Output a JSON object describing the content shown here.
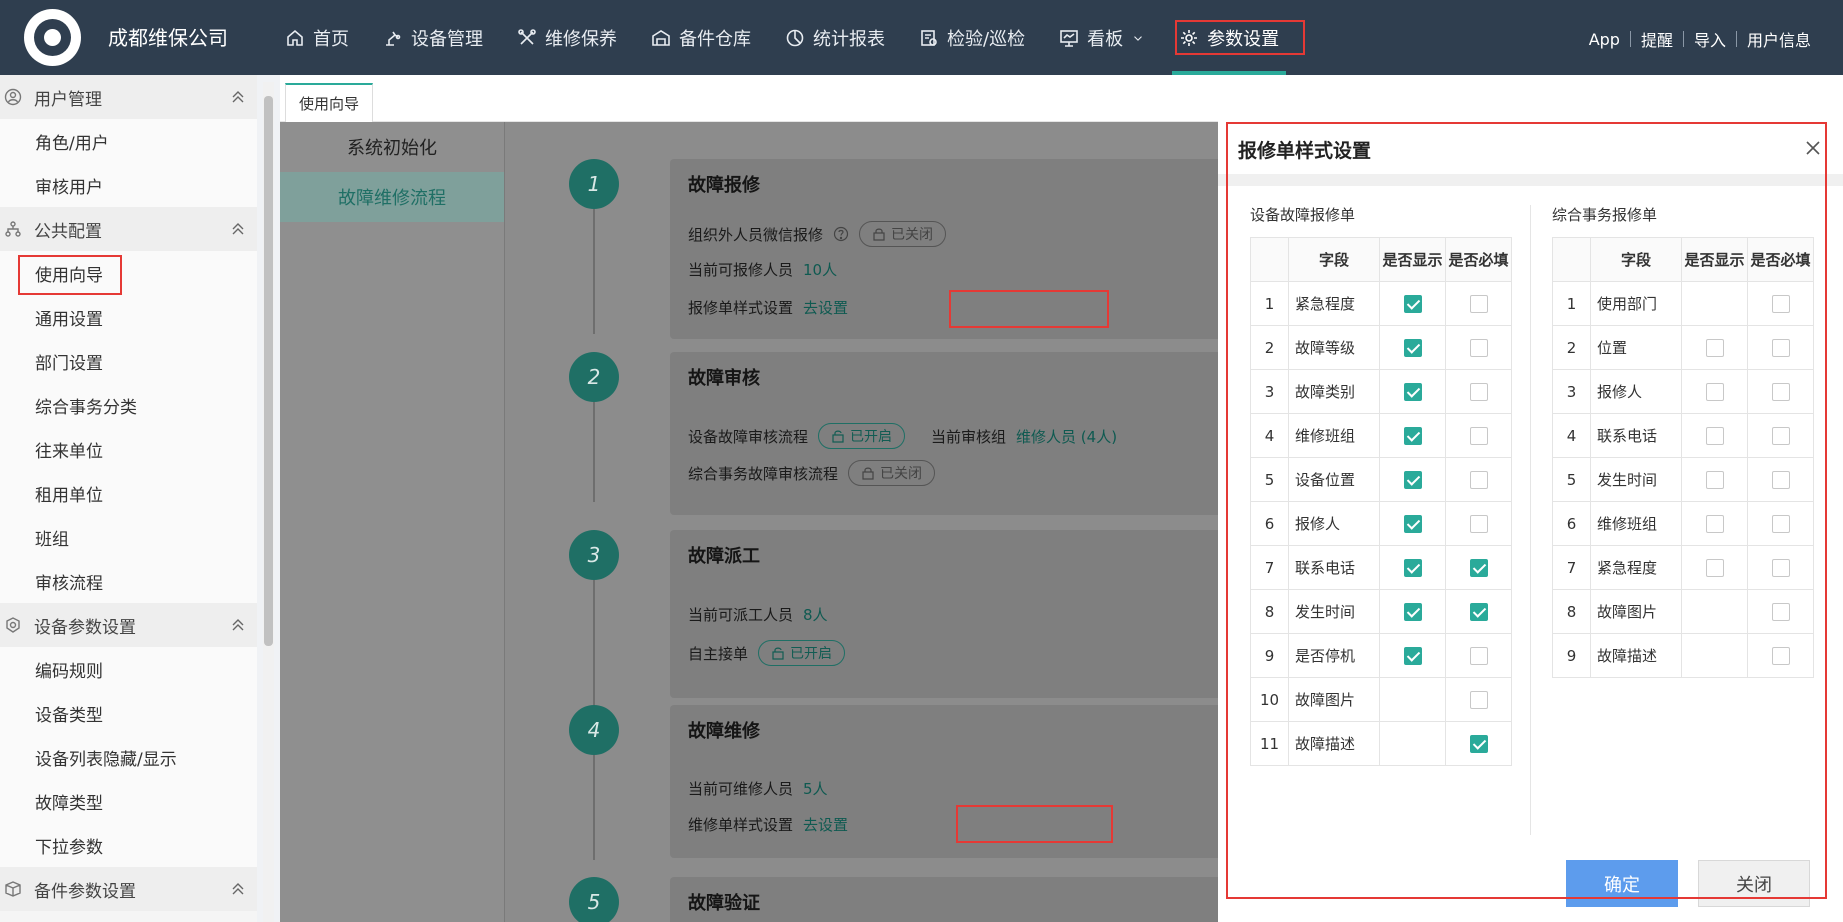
{
  "header": {
    "company": "成都维保公司",
    "nav": [
      {
        "label": "首页",
        "icon": "home-icon"
      },
      {
        "label": "设备管理",
        "icon": "robot-arm-icon"
      },
      {
        "label": "维修保养",
        "icon": "tools-icon"
      },
      {
        "label": "备件仓库",
        "icon": "warehouse-icon"
      },
      {
        "label": "统计报表",
        "icon": "pie-chart-icon"
      },
      {
        "label": "检验/巡检",
        "icon": "inspection-icon"
      },
      {
        "label": "看板",
        "icon": "board-icon"
      },
      {
        "label": "参数设置",
        "icon": "gear-icon"
      }
    ],
    "right": [
      "App",
      "提醒",
      "导入",
      "用户信息"
    ]
  },
  "sidebar": {
    "groups": [
      {
        "label": "用户管理",
        "icon": "user-circle-icon",
        "items": [
          "角色/用户",
          "审核用户"
        ]
      },
      {
        "label": "公共配置",
        "icon": "org-tree-icon",
        "items": [
          "使用向导",
          "通用设置",
          "部门设置",
          "综合事务分类",
          "往来单位",
          "租用单位",
          "班组",
          "审核流程"
        ]
      },
      {
        "label": "设备参数设置",
        "icon": "device-params-icon",
        "items": [
          "编码规则",
          "设备类型",
          "设备列表隐藏/显示",
          "故障类型",
          "下拉参数"
        ]
      },
      {
        "label": "备件参数设置",
        "icon": "box-icon",
        "items": []
      }
    ]
  },
  "tabs": [
    "使用向导"
  ],
  "submenu": [
    "系统初始化",
    "故障维修流程"
  ],
  "flow": {
    "steps": [
      {
        "num": "1",
        "title": "故障报修",
        "rows": [
          {
            "label": "组织外人员微信报修",
            "help": true,
            "pill": "已关闭",
            "pill_on": false
          },
          {
            "label": "当前可报修人员",
            "link": "10人"
          },
          {
            "label": "报修单样式设置",
            "link": "去设置"
          }
        ]
      },
      {
        "num": "2",
        "title": "故障审核",
        "rows": [
          {
            "label": "设备故障审核流程",
            "pill": "已开启",
            "pill_on": true,
            "extra_label": "当前审核组",
            "extra_link": "维修人员 (4人)"
          },
          {
            "label": "综合事务故障审核流程",
            "pill": "已关闭",
            "pill_on": false
          }
        ]
      },
      {
        "num": "3",
        "title": "故障派工",
        "rows": [
          {
            "label": "当前可派工人员",
            "link": "8人"
          },
          {
            "label": "自主接单",
            "pill": "已开启",
            "pill_on": true
          }
        ]
      },
      {
        "num": "4",
        "title": "故障维修",
        "rows": [
          {
            "label": "当前可维修人员",
            "link": "5人"
          },
          {
            "label": "维修单样式设置",
            "link": "去设置"
          }
        ]
      },
      {
        "num": "5",
        "title": "故障验证",
        "rows": []
      }
    ]
  },
  "dialog": {
    "title": "报修单样式设置",
    "left": {
      "title": "设备故障报修单",
      "headers": [
        "字段",
        "是否显示",
        "是否必填"
      ],
      "rows": [
        {
          "n": "1",
          "name": "紧急程度",
          "show": true,
          "required": false
        },
        {
          "n": "2",
          "name": "故障等级",
          "show": true,
          "required": false
        },
        {
          "n": "3",
          "name": "故障类别",
          "show": true,
          "required": false
        },
        {
          "n": "4",
          "name": "维修班组",
          "show": true,
          "required": false
        },
        {
          "n": "5",
          "name": "设备位置",
          "show": true,
          "required": false
        },
        {
          "n": "6",
          "name": "报修人",
          "show": true,
          "required": false
        },
        {
          "n": "7",
          "name": "联系电话",
          "show": true,
          "required": true
        },
        {
          "n": "8",
          "name": "发生时间",
          "show": true,
          "required": true
        },
        {
          "n": "9",
          "name": "是否停机",
          "show": true,
          "required": false
        },
        {
          "n": "10",
          "name": "故障图片",
          "show": null,
          "required": false
        },
        {
          "n": "11",
          "name": "故障描述",
          "show": null,
          "required": true
        }
      ]
    },
    "right": {
      "title": "综合事务报修单",
      "headers": [
        "字段",
        "是否显示",
        "是否必填"
      ],
      "rows": [
        {
          "n": "1",
          "name": "使用部门",
          "show": null,
          "required": false
        },
        {
          "n": "2",
          "name": "位置",
          "show": false,
          "required": false
        },
        {
          "n": "3",
          "name": "报修人",
          "show": false,
          "required": false
        },
        {
          "n": "4",
          "name": "联系电话",
          "show": false,
          "required": false
        },
        {
          "n": "5",
          "name": "发生时间",
          "show": false,
          "required": false
        },
        {
          "n": "6",
          "name": "维修班组",
          "show": false,
          "required": false
        },
        {
          "n": "7",
          "name": "紧急程度",
          "show": false,
          "required": false
        },
        {
          "n": "8",
          "name": "故障图片",
          "show": null,
          "required": false
        },
        {
          "n": "9",
          "name": "故障描述",
          "show": null,
          "required": false
        }
      ]
    },
    "ok_label": "确定",
    "close_label": "关闭"
  },
  "colors": {
    "topbar": "#2f3e4f",
    "accent": "#2aaa9a",
    "highlight": "#e53935",
    "primary_button": "#5d9ced"
  }
}
